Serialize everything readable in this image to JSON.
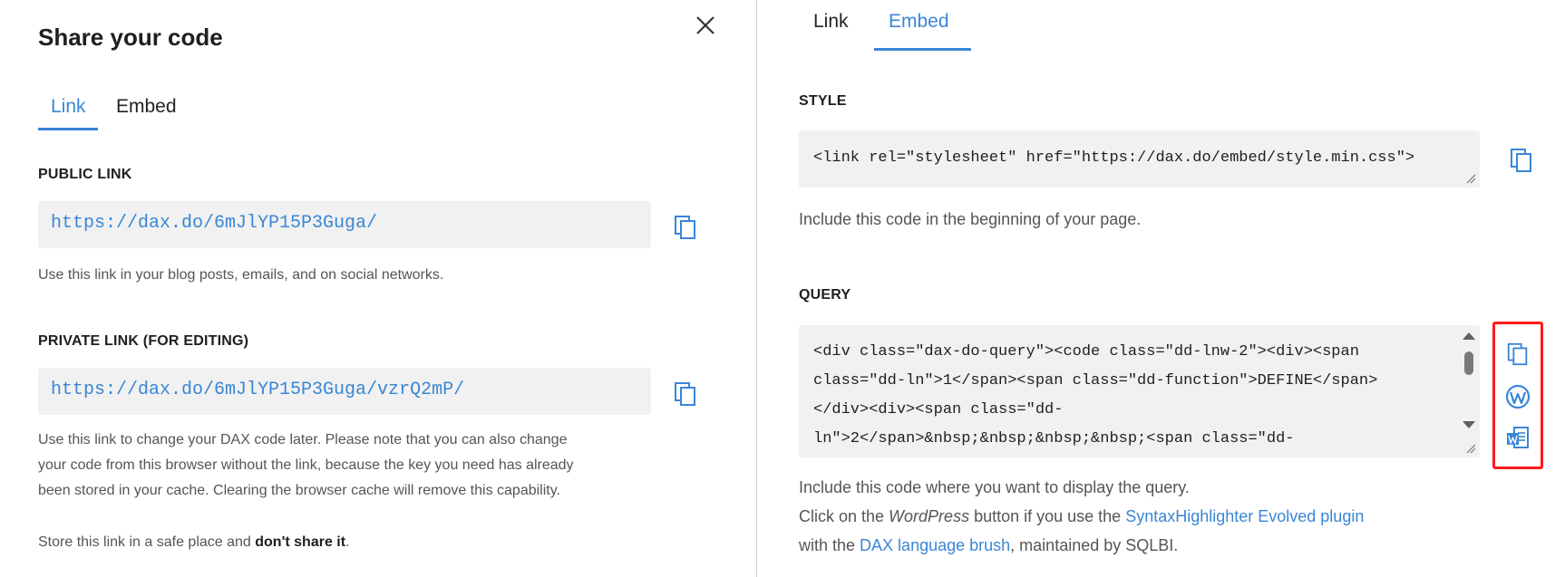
{
  "left": {
    "title": "Share your code",
    "tabs": [
      {
        "label": "Link",
        "active": true
      },
      {
        "label": "Embed",
        "active": false
      }
    ],
    "public_link": {
      "label": "PUBLIC LINK",
      "value": "https://dax.do/6mJlYP15P3Guga/",
      "help": "Use this link in your blog posts, emails, and on social networks."
    },
    "private_link": {
      "label": "PRIVATE LINK (FOR EDITING)",
      "value": "https://dax.do/6mJlYP15P3Guga/vzrQ2mP/",
      "help_lines": [
        "Use this link to change your DAX code later. Please note that you can also change",
        "your code from this browser without the link, because the key you need has already",
        "been stored in your cache. Clearing the browser cache will remove this capability."
      ],
      "note_prefix": "Store this link in a safe place and ",
      "note_bold": "don't share it",
      "note_suffix": "."
    },
    "close_icon": "close-icon"
  },
  "right": {
    "tabs": [
      {
        "label": "Link",
        "active": false
      },
      {
        "label": "Embed",
        "active": true
      }
    ],
    "style": {
      "label": "STYLE",
      "code": "<link rel=\"stylesheet\" href=\"https://dax.do/embed/style.min.css\">",
      "help": "Include this code in the beginning of your page."
    },
    "query": {
      "label": "QUERY",
      "code_lines": [
        "<div class=\"dax-do-query\"><code class=\"dd-lnw-2\"><div><span",
        "class=\"dd-ln\">1</span><span class=\"dd-function\">DEFINE</span>",
        "</div><div><span class=\"dd-",
        "ln\">2</span>&nbsp;&nbsp;&nbsp;&nbsp;<span class=\"dd-"
      ],
      "help_line1": "Include this code where you want to display the query.",
      "help_line2_pre": "Click on the ",
      "help_line2_em": "WordPress",
      "help_line2_mid": " button if you use the ",
      "help_line2_link": "SyntaxHighlighter Evolved plugin",
      "help_line3_pre": "with the ",
      "help_line3_link": "DAX language brush",
      "help_line3_suffix": ", maintained by SQLBI."
    },
    "icons": [
      "copy-icon",
      "wordpress-icon",
      "word-document-icon"
    ]
  },
  "colors": {
    "accent": "#3a86d6",
    "highlight_border": "#ff1a1a",
    "field_background": "#f1f1f1"
  }
}
